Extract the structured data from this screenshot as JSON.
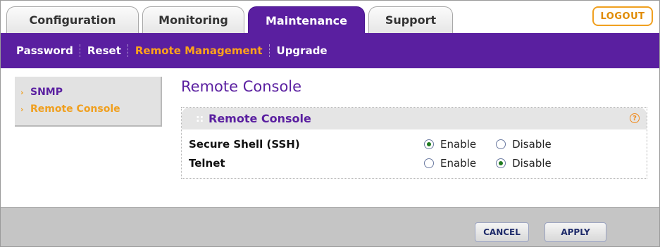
{
  "tabs": [
    {
      "label": "Configuration",
      "active": false
    },
    {
      "label": "Monitoring",
      "active": false
    },
    {
      "label": "Maintenance",
      "active": true
    },
    {
      "label": "Support",
      "active": false
    }
  ],
  "logout_label": "LOGOUT",
  "subnav": [
    {
      "label": "Password",
      "active": false
    },
    {
      "label": "Reset",
      "active": false
    },
    {
      "label": "Remote Management",
      "active": true
    },
    {
      "label": "Upgrade",
      "active": false
    }
  ],
  "sidebar": {
    "items": [
      {
        "label": "SNMP",
        "active": false
      },
      {
        "label": "Remote Console",
        "active": true
      }
    ]
  },
  "page_title": "Remote Console",
  "panel": {
    "title": "Remote Console",
    "help_icon": "?",
    "rows": [
      {
        "label": "Secure Shell (SSH)",
        "options": [
          "Enable",
          "Disable"
        ],
        "selected": "Enable"
      },
      {
        "label": "Telnet",
        "options": [
          "Enable",
          "Disable"
        ],
        "selected": "Disable"
      }
    ]
  },
  "buttons": {
    "cancel": "CANCEL",
    "apply": "APPLY"
  },
  "colors": {
    "brand_purple": "#5a1fa0",
    "accent_orange": "#f0a020"
  }
}
